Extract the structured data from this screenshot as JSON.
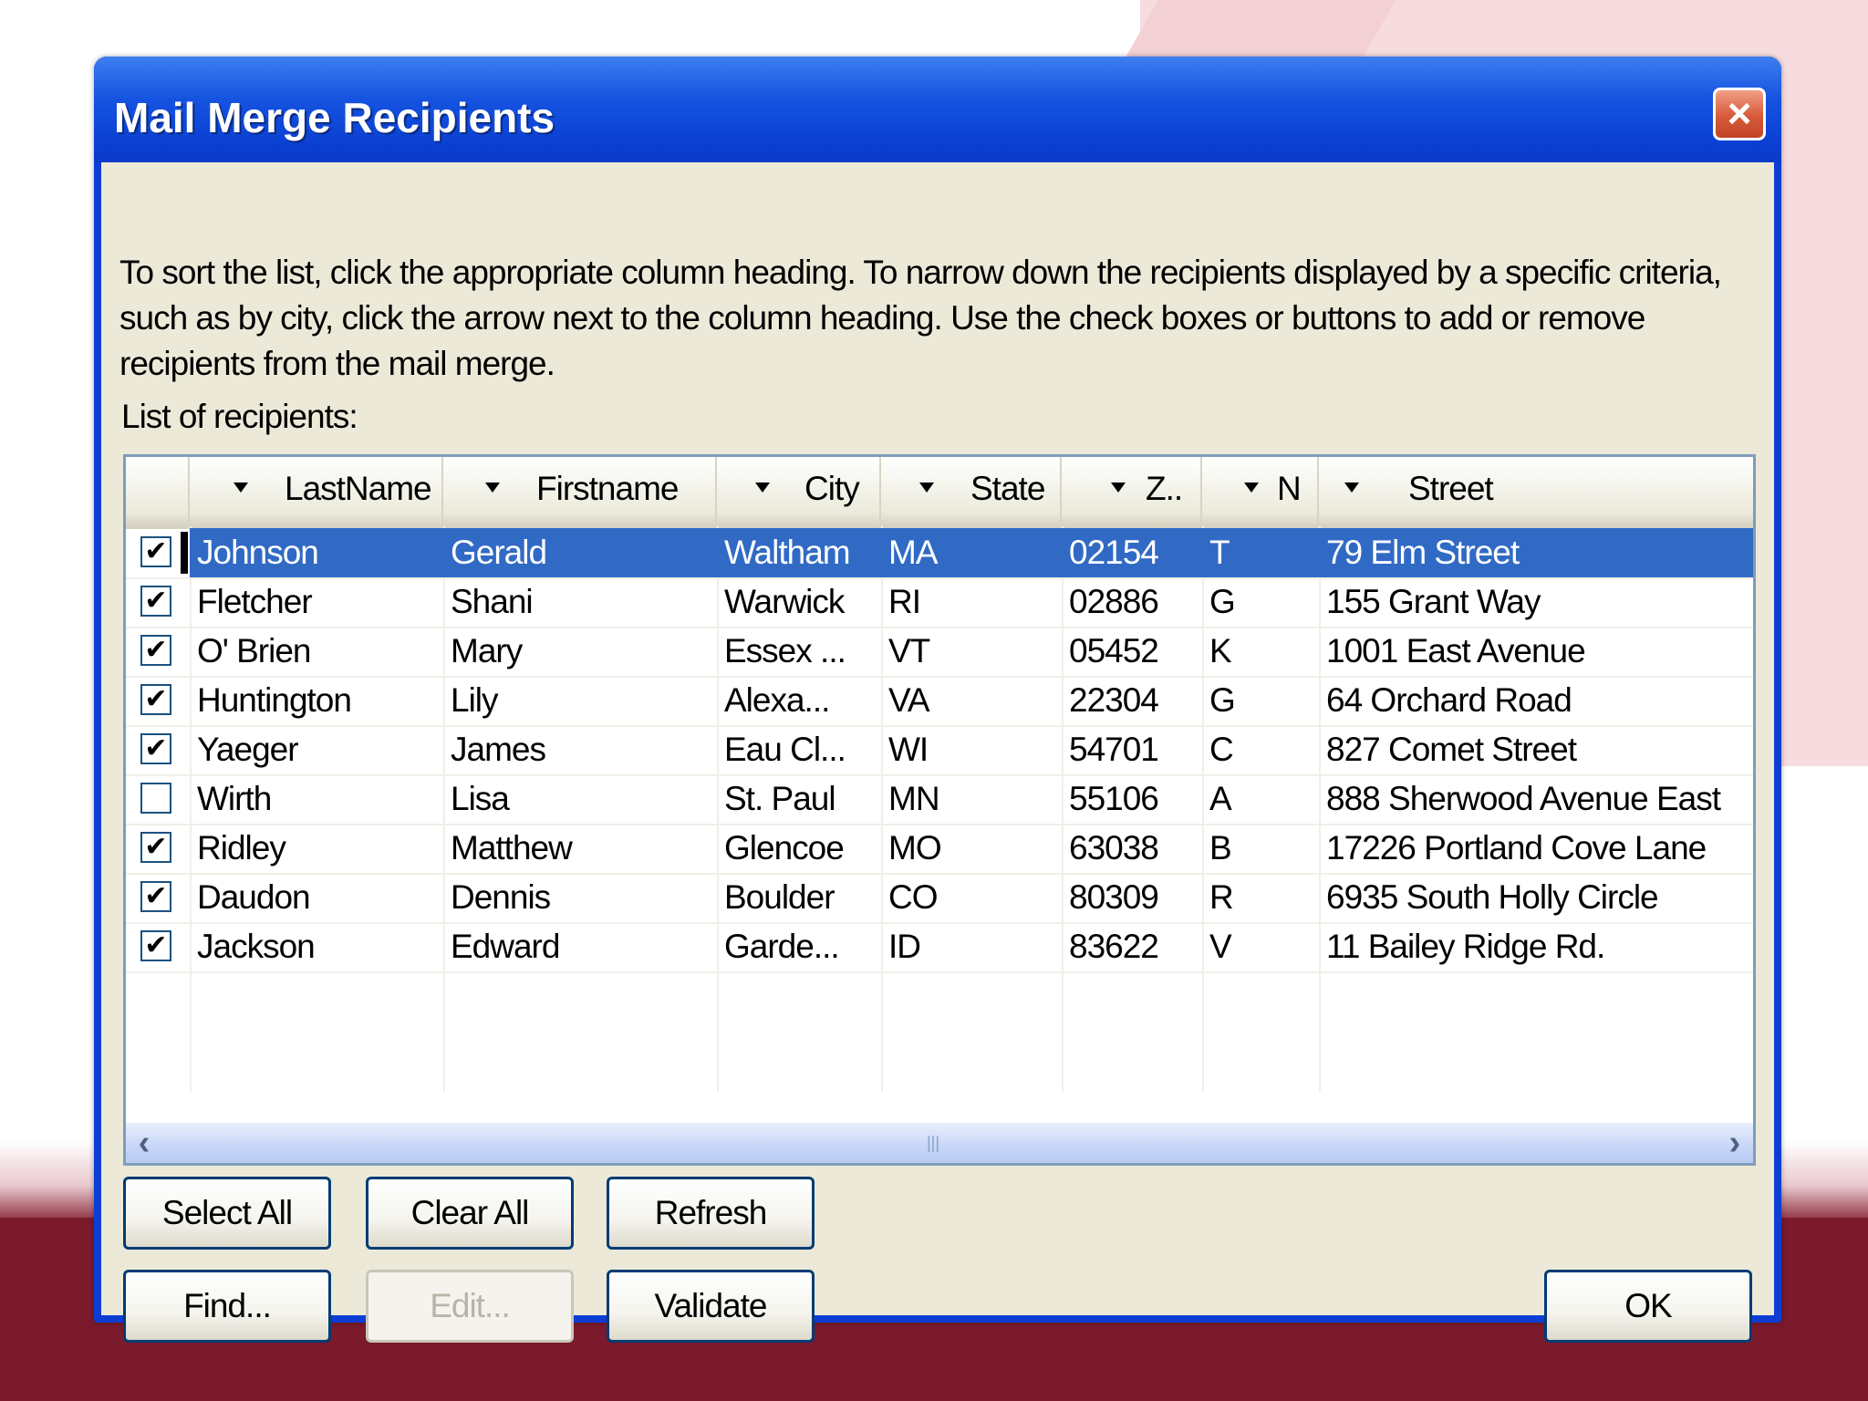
{
  "dialog": {
    "title": "Mail Merge Recipients",
    "close_label": "×",
    "description": [
      "To sort the list, click the appropriate column heading.  To narrow down the recipients displayed by a specific criteria,",
      "such as by city, click the arrow next to the column heading.  Use the check boxes or buttons to add or remove",
      "recipients from the mail merge."
    ],
    "list_label": "List of recipients:"
  },
  "columns": [
    "LastName",
    "Firstname",
    "City",
    "State",
    "Z..",
    "N",
    "Street"
  ],
  "rows": [
    {
      "checked": true,
      "cells": [
        "Johnson",
        "Gerald",
        "Waltham",
        "MA",
        "02154",
        "T",
        "79 Elm Street"
      ]
    },
    {
      "checked": true,
      "cells": [
        "Fletcher",
        "Shani",
        "Warwick",
        "RI",
        "02886",
        "G",
        "155 Grant Way"
      ]
    },
    {
      "checked": true,
      "cells": [
        "O' Brien",
        "Mary",
        "Essex ...",
        "VT",
        "05452",
        "K",
        "1001 East Avenue"
      ]
    },
    {
      "checked": true,
      "cells": [
        "Huntington",
        "Lily",
        "Alexa...",
        "VA",
        "22304",
        "G",
        "64 Orchard Road"
      ]
    },
    {
      "checked": true,
      "cells": [
        "Yaeger",
        "James",
        "Eau Cl...",
        "WI",
        "54701",
        "C",
        "827 Comet Street"
      ]
    },
    {
      "checked": false,
      "cells": [
        "Wirth",
        "Lisa",
        "St. Paul",
        "MN",
        "55106",
        "A",
        "888 Sherwood Avenue East"
      ]
    },
    {
      "checked": true,
      "cells": [
        "Ridley",
        "Matthew",
        "Glencoe",
        "MO",
        "63038",
        "B",
        "17226 Portland Cove Lane"
      ]
    },
    {
      "checked": true,
      "cells": [
        "Daudon",
        "Dennis",
        "Boulder",
        "CO",
        "80309",
        "R",
        "6935 South Holly Circle"
      ]
    },
    {
      "checked": true,
      "cells": [
        "Jackson",
        "Edward",
        "Garde...",
        "ID",
        "83622",
        "V",
        "11 Bailey Ridge Rd."
      ]
    }
  ],
  "selected_row": 0,
  "checkmark": "✔",
  "scroll": {
    "left": "‹",
    "right": "›",
    "grip": "|||"
  },
  "buttons": {
    "select_all": "Select All",
    "clear_all": "Clear All",
    "refresh": "Refresh",
    "find": "Find...",
    "edit": "Edit...",
    "validate": "Validate",
    "ok": "OK"
  },
  "colors": {
    "title_bar": "#0a3fd2",
    "selection": "#316ac5",
    "background": "#ece9d8",
    "slide_band": "#7a1a2c"
  }
}
